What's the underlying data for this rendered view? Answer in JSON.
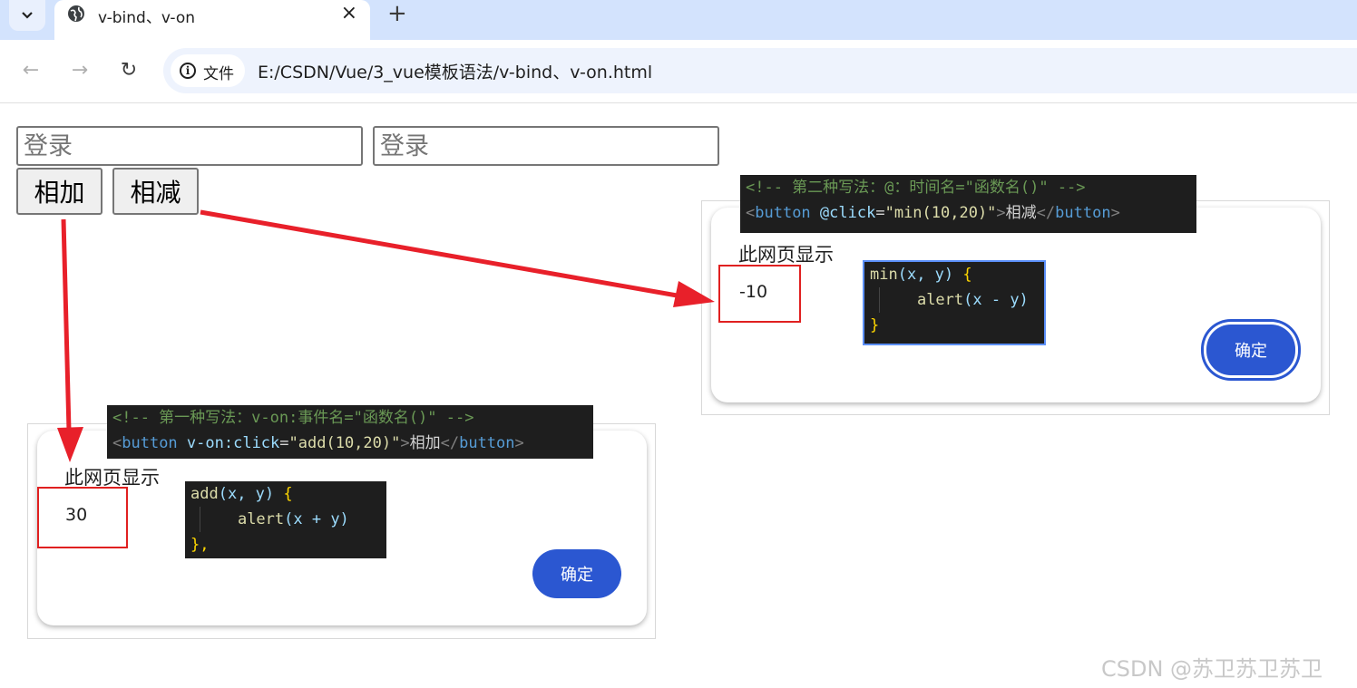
{
  "tab": {
    "title": "v-bind、v-on",
    "close": "×",
    "new_tab": "+"
  },
  "toolbar": {
    "back": "←",
    "forward": "→",
    "reload": "↻",
    "site_chip_label": "文件",
    "url": "E:/CSDN/Vue/3_vue模板语法/v-bind、v-on.html"
  },
  "page": {
    "input1_placeholder": "登录",
    "input2_placeholder": "登录",
    "add_button": "相加",
    "sub_button": "相减"
  },
  "alert_sub": {
    "title": "此网页显示",
    "value": "-10",
    "ok": "确定",
    "snippet_comment": "<!-- 第二种写法：@：时间名=\"函数名()\" -->",
    "snippet_tag": {
      "lt": "<",
      "tag": "button",
      "attr": "@click",
      "eq": "=",
      "value": "\"min(10,20)\"",
      "gt": ">",
      "text": "相减",
      "close_lt": "</",
      "close_tag": "button",
      "close_gt": ">"
    },
    "fn": {
      "name": "min",
      "params_open": "(x, y)",
      "brace_open": "{",
      "body_fn": "alert",
      "body_args": "(x - y)",
      "brace_close": "}"
    }
  },
  "alert_add": {
    "title": "此网页显示",
    "value": "30",
    "ok": "确定",
    "snippet_comment": "<!-- 第一种写法：v-on:事件名=\"函数名()\" -->",
    "snippet_tag": {
      "lt": "<",
      "tag": "button",
      "attr": "v-on:click",
      "eq": "=",
      "value": "\"add(10,20)\"",
      "gt": ">",
      "text": "相加",
      "close_lt": "</",
      "close_tag": "button",
      "close_gt": ">"
    },
    "fn": {
      "name": "add",
      "params_open": "(x, y)",
      "brace_open": "{",
      "body_fn": "alert",
      "body_args": "(x + y)",
      "brace_close": "},"
    }
  },
  "watermark": "CSDN @苏卫苏卫苏卫",
  "colors": {
    "tabbar": "#d3e3fd",
    "ok_button": "#2b57d1",
    "highlight_box": "#e02020",
    "arrow": "#e8202a"
  }
}
